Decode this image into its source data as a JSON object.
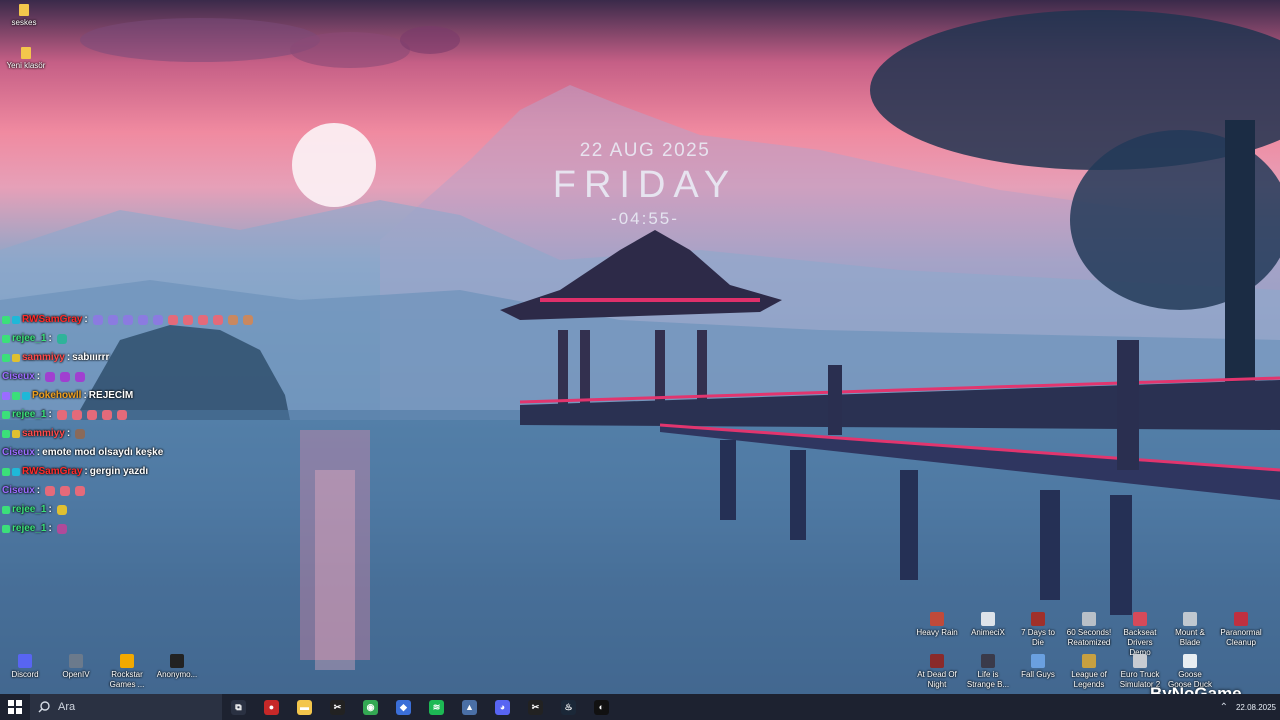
{
  "clock": {
    "date": "22 AUG 2025",
    "day": "FRIDAY",
    "time": "-04:55-"
  },
  "top_icons": [
    {
      "label": "seskes",
      "icon": "folder-icon"
    },
    {
      "label": "Yeni klasör",
      "icon": "folder-icon"
    }
  ],
  "chat": [
    {
      "user": "RWSamGray",
      "user_color": "#ff2a2a",
      "message": "",
      "emotes": 11
    },
    {
      "user": "rejee_1",
      "user_color": "#3be07a",
      "message": "",
      "emotes": 1
    },
    {
      "user": "sammiyy",
      "user_color": "#ff4a4a",
      "message": "sabııırrr",
      "emotes": 0
    },
    {
      "user": "Ciseux",
      "user_color": "#9b6bff",
      "message": "",
      "emotes": 3
    },
    {
      "user": "Pokehowll",
      "user_color": "#f0a020",
      "message": "REJECİM",
      "emotes": 0
    },
    {
      "user": "rejee_1",
      "user_color": "#3be07a",
      "message": "",
      "emotes": 5
    },
    {
      "user": "sammiyy",
      "user_color": "#ff4a4a",
      "message": "",
      "emotes": 1
    },
    {
      "user": "Ciseux",
      "user_color": "#9b6bff",
      "message": "emote mod olsaydı keşke",
      "emotes": 0
    },
    {
      "user": "RWSamGray",
      "user_color": "#ff2a2a",
      "message": "gergin yazdı",
      "emotes": 0
    },
    {
      "user": "Ciseux",
      "user_color": "#9b6bff",
      "message": "",
      "emotes": 3
    },
    {
      "user": "rejee_1",
      "user_color": "#3be07a",
      "message": "",
      "emotes": 1
    },
    {
      "user": "rejee_1",
      "user_color": "#3be07a",
      "message": "",
      "emotes": 1
    }
  ],
  "bottom_left_icons": [
    {
      "label": "Discord",
      "icon": "discord-icon",
      "color": "#5865f2"
    },
    {
      "label": "OpenIV",
      "icon": "openiv-icon",
      "color": "#6b7a8c"
    },
    {
      "label": "Rockstar Games ...",
      "icon": "rockstar-icon",
      "color": "#f2a900"
    },
    {
      "label": "Anonymo...",
      "icon": "anonymous-icon",
      "color": "#222222"
    }
  ],
  "game_icons_row1": [
    {
      "label": "Heavy Rain",
      "icon": "heavy-rain-icon"
    },
    {
      "label": "AnimeciX",
      "icon": "animecix-icon"
    },
    {
      "label": "7 Days to Die",
      "icon": "7-days-to-die-icon"
    },
    {
      "label": "60 Seconds! Reatomized",
      "icon": "60-seconds-icon"
    },
    {
      "label": "Backseat Drivers Demo",
      "icon": "backseat-drivers-icon"
    },
    {
      "label": "Mount & Blade",
      "icon": "mount-blade-icon"
    },
    {
      "label": "Paranormal Cleanup",
      "icon": "paranormal-cleanup-icon"
    }
  ],
  "game_icons_row2": [
    {
      "label": "At Dead Of Night",
      "icon": "at-dead-of-night-icon"
    },
    {
      "label": "Life is Strange B...",
      "icon": "life-is-strange-icon"
    },
    {
      "label": "Fall Guys",
      "icon": "fall-guys-icon"
    },
    {
      "label": "League of Legends",
      "icon": "league-of-legends-icon"
    },
    {
      "label": "Euro Truck Simulator 2",
      "icon": "euro-truck-icon"
    },
    {
      "label": "Goose Goose Duck",
      "icon": "goose-goose-duck-icon"
    }
  ],
  "taskbar": {
    "search_placeholder": "Ara",
    "apps": [
      {
        "name": "task-view",
        "glyph": "⧉",
        "color": "#2a3142"
      },
      {
        "name": "app-red",
        "glyph": "●",
        "color": "#c62828"
      },
      {
        "name": "file-explorer",
        "glyph": "▬",
        "color": "#f3c64c"
      },
      {
        "name": "capcut",
        "glyph": "✂",
        "color": "#222222"
      },
      {
        "name": "chrome",
        "glyph": "◉",
        "color": "#34a853"
      },
      {
        "name": "app-blue",
        "glyph": "◆",
        "color": "#3b6fd8"
      },
      {
        "name": "spotify",
        "glyph": "≋",
        "color": "#1db954"
      },
      {
        "name": "app-kite",
        "glyph": "▲",
        "color": "#4a6fa5"
      },
      {
        "name": "discord",
        "glyph": "◕",
        "color": "#5865f2"
      },
      {
        "name": "capcut-2",
        "glyph": "✂",
        "color": "#222222"
      },
      {
        "name": "steam",
        "glyph": "♨",
        "color": "#1b2838"
      },
      {
        "name": "github",
        "glyph": "◐",
        "color": "#111111"
      }
    ],
    "date": "22.08.2025"
  },
  "watermark": "ByNoGame"
}
